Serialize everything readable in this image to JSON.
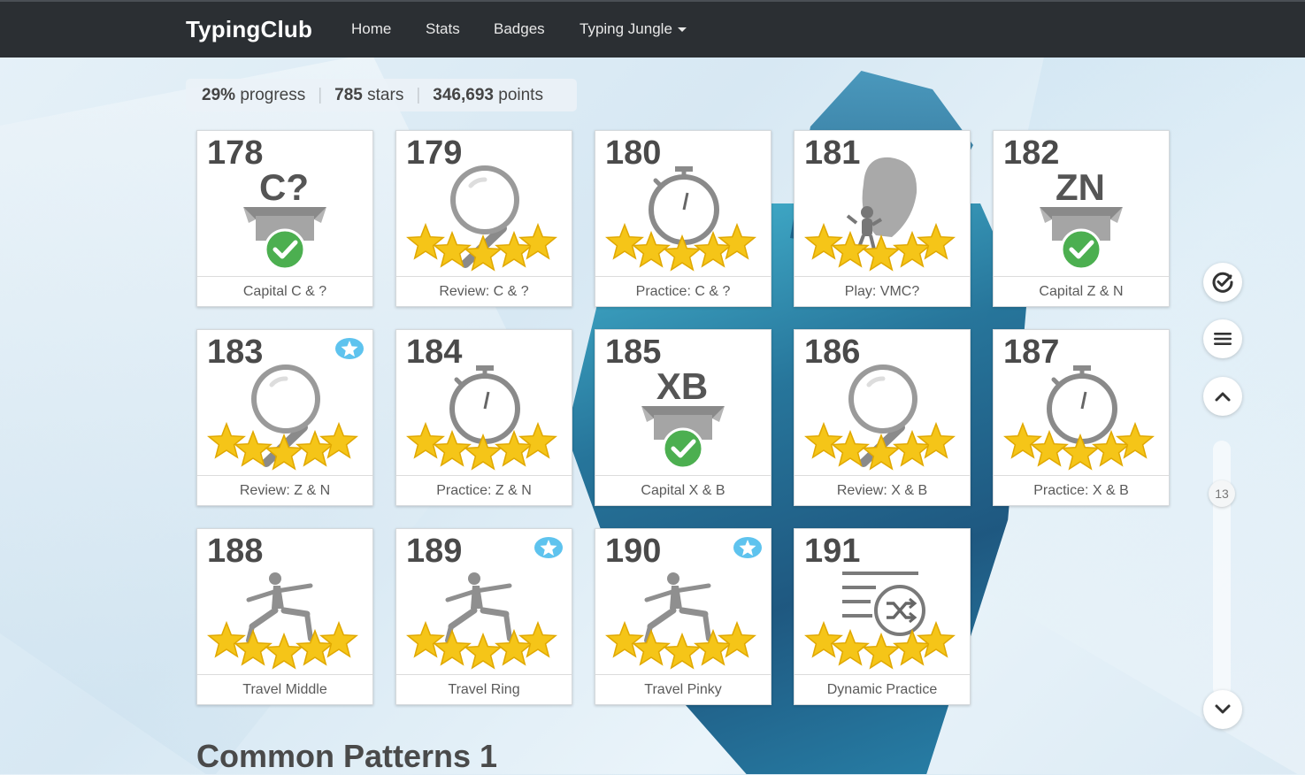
{
  "nav": {
    "brand": "TypingClub",
    "items": [
      "Home",
      "Stats",
      "Badges"
    ],
    "dropdown": "Typing Jungle"
  },
  "stats": {
    "progress_value": "29%",
    "progress_label": "progress",
    "stars_value": "785",
    "stars_label": "stars",
    "points_value": "346,693",
    "points_label": "points"
  },
  "lessons": [
    {
      "num": "178",
      "title": "Capital C & ?",
      "kind": "box",
      "box_text": "C?",
      "stars": 0,
      "badge": false,
      "done": true
    },
    {
      "num": "179",
      "title": "Review: C & ?",
      "kind": "magnifier",
      "stars": 5,
      "badge": false
    },
    {
      "num": "180",
      "title": "Practice: C & ?",
      "kind": "stopwatch",
      "stars": 5,
      "badge": false
    },
    {
      "num": "181",
      "title": "Play: VMC?",
      "kind": "balloon",
      "stars": 5,
      "badge": false
    },
    {
      "num": "182",
      "title": "Capital Z & N",
      "kind": "box",
      "box_text": "ZN",
      "stars": 0,
      "badge": false,
      "done": true
    },
    {
      "num": "183",
      "title": "Review: Z & N",
      "kind": "magnifier",
      "stars": 5,
      "badge": true
    },
    {
      "num": "184",
      "title": "Practice: Z & N",
      "kind": "stopwatch",
      "stars": 5,
      "badge": false
    },
    {
      "num": "185",
      "title": "Capital X & B",
      "kind": "box",
      "box_text": "XB",
      "stars": 0,
      "badge": false,
      "done": true
    },
    {
      "num": "186",
      "title": "Review: X & B",
      "kind": "magnifier",
      "stars": 5,
      "badge": false
    },
    {
      "num": "187",
      "title": "Practice: X & B",
      "kind": "stopwatch",
      "stars": 5,
      "badge": false
    },
    {
      "num": "188",
      "title": "Travel Middle",
      "kind": "yoga",
      "stars": 5,
      "badge": false
    },
    {
      "num": "189",
      "title": "Travel Ring",
      "kind": "yoga",
      "stars": 5,
      "badge": true
    },
    {
      "num": "190",
      "title": "Travel Pinky",
      "kind": "yoga",
      "stars": 5,
      "badge": true
    },
    {
      "num": "191",
      "title": "Dynamic Practice",
      "kind": "shuffle",
      "stars": 5,
      "badge": false
    }
  ],
  "sidebar": {
    "buttons": [
      "check-circle-icon",
      "menu-icon",
      "chevron-up-icon",
      "chevron-down-icon"
    ],
    "page_number": "13"
  },
  "section_title": "Common Patterns 1",
  "colors": {
    "navbar": "#2b2f33",
    "star": "#f5c518",
    "check": "#4caf50",
    "icon_gray": "#8a8a8a",
    "badge": "#5ec3ee"
  }
}
